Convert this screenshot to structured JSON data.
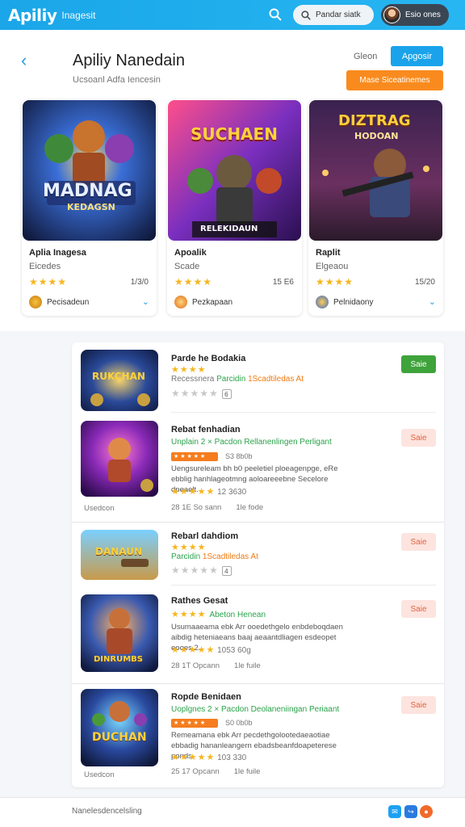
{
  "app": {
    "logo": "Apiliy",
    "logo_sub": "Inagesit"
  },
  "search": {
    "placeholder": "Pandar siatk"
  },
  "profile": {
    "name": "Esio ones"
  },
  "page": {
    "title": "Apiliy Nanedain",
    "subtitle": "Ucsoanl Adfa Iencesin",
    "link": "Gleon",
    "primary_button": "Apgosir",
    "secondary_button": "Mase Siceatinemes"
  },
  "featured": [
    {
      "name": "Aplia Inagesa",
      "genre": "Eicedes",
      "stars": "★★★★",
      "rating": 4,
      "count": "1/3/0",
      "developer": "Pecisadeun",
      "art_title": "MADNAG",
      "art_sub": "KEDAGSN"
    },
    {
      "name": "Apoalik",
      "genre": "Scade",
      "stars": "★★★★",
      "rating": 4,
      "count": "15 E6",
      "developer": "Pezkapaan",
      "art_title": "SUCHAEN",
      "art_sub": "RELEKIDAUN"
    },
    {
      "name": "Raplit",
      "genre": "Elgeaou",
      "stars": "★★★★",
      "rating": 4,
      "count": "15/20",
      "developer": "Pelnidaony",
      "art_title": "DIZTRAG",
      "art_sub": "HODOAN"
    }
  ],
  "apps": [
    {
      "name": "Parde he Bodakia",
      "stars": "★★★★",
      "rating": 4,
      "tag_grey": "Recessnera",
      "tag_green": "Parcidin",
      "tag_orange": "1Scadtiledas At",
      "grey_stars": "★★★★★",
      "mini": "6",
      "action": "Saie",
      "action_style": "green",
      "thumb_title": "RUKCHAN"
    },
    {
      "name": "Rebat fenhadian",
      "tag": "Unplain 2 × Pacdon Rellanenlingen Perligant",
      "badge": "★ ★ ★ ★ ★",
      "badge_sub": "S3 8b0b",
      "desc": "Uengsureleam bh b0 peeletiel ploeagenpge, eRe ebblig hanhlageotmng aoloareeebne Secelore dpeaelt.",
      "rating_stars": "★★★★★",
      "rating": 4.5,
      "rating_text": "12 3630",
      "meta1": "28 1E So sann",
      "meta2": "1le fode",
      "side": "Usedcon",
      "action": "Saie",
      "action_style": "pink",
      "thumb_title": ""
    },
    {
      "name": "Rebarl dahdiom",
      "stars": "★★★★",
      "rating": 4,
      "tag_green": "Parcidin",
      "tag_orange": "1Scadtiledas At",
      "grey_stars": "★★★★★",
      "mini": "4",
      "action": "Saie",
      "action_style": "pink",
      "thumb_title": "DANAUN"
    },
    {
      "name": "Rathes Gesat",
      "stars": "★★★★",
      "rating": 4.5,
      "tag_green": "Abeton Henean",
      "desc": "Usumaaeama ebk Arr ooedethgelo enbdeboqdaen aibdig heteniaeans baaj aeaantdliagen esdeopet eooes 2.",
      "rating_stars": "★★★★★",
      "rating_text": "1053 60g",
      "meta1": "28 1T Opcann",
      "meta2": "1le fuile",
      "action": "Saie",
      "action_style": "pink",
      "thumb_title": "DINRUMBS"
    },
    {
      "name": "Ropde Benidaen",
      "tag": "Uoplgnes 2 × Pacdon Deolaneniingan Periaant",
      "badge": "★ ★ ★ ★ ★",
      "badge_sub": "S0 0b0b",
      "desc": "Remeamana ebk Arr pecdethgolootedaeaotiae ebbadig hananleangern ebadsbeanfdoapeterese ponds.",
      "rating_stars": "★★★★★",
      "rating": 4.5,
      "rating_text": "103 330",
      "meta1": "25 17 Opcann",
      "meta2": "1le fuile",
      "side": "Usedcon",
      "action": "Saie",
      "action_style": "pink",
      "thumb_title": "DUCHAN"
    }
  ],
  "footer": {
    "text": "Nanelesdencelsling"
  },
  "colors": {
    "accent": "#1aa6e8",
    "orange": "#f98b1e",
    "green": "#3fa33b",
    "star": "#f6b51e"
  }
}
